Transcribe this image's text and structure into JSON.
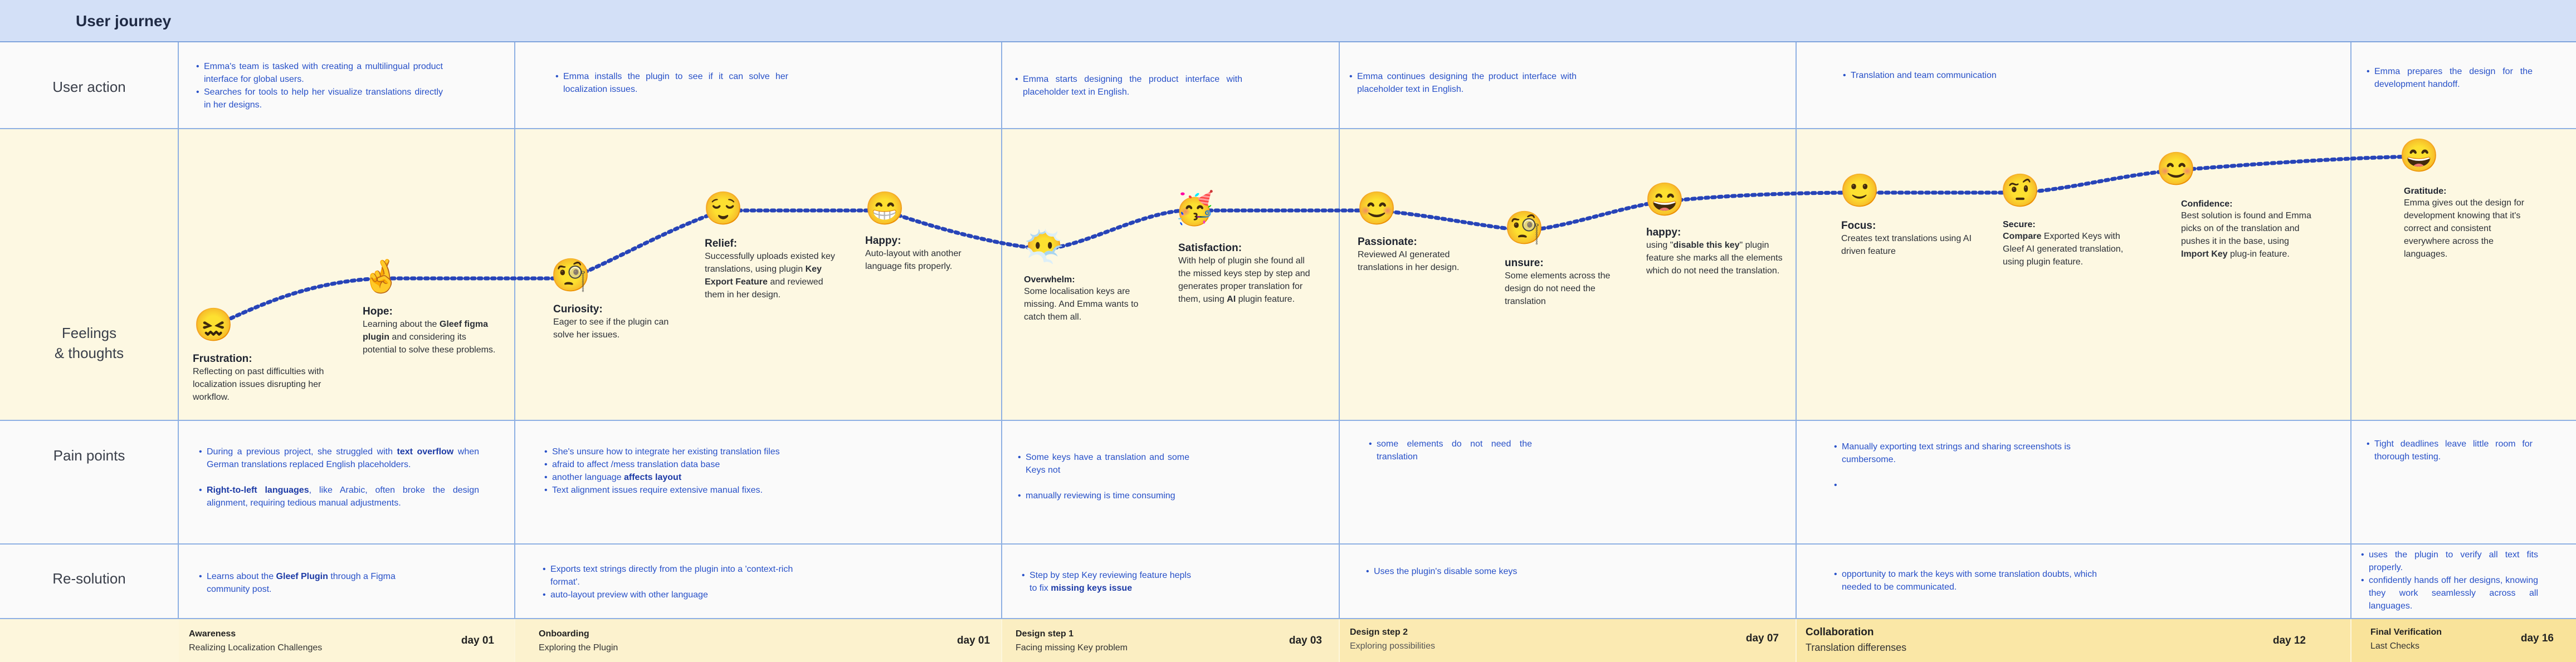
{
  "title": "User journey",
  "rows": {
    "user_action": "User action",
    "feelings_line1": "Feelings",
    "feelings_line2": "& thoughts",
    "pain_points": "Pain points",
    "resolution": "Re-solution"
  },
  "user_actions": [
    [
      "Emma's team is tasked with creating a multilingual product interface for global users.",
      "Searches for tools to help her visualize translations directly in her designs."
    ],
    [
      "Emma installs the plugin to see if it can solve her localization issues."
    ],
    [
      "Emma starts designing the product interface with placeholder text in English."
    ],
    [
      "Emma continues designing the product interface with placeholder text in English."
    ],
    [
      "Translation and team communication"
    ],
    [
      "Emma prepares the design for the development handoff."
    ]
  ],
  "emotions": [
    {
      "icon": "confounded-face-icon",
      "glyph": "😖",
      "title": "Frustration:",
      "text": "Reflecting on past difficulties with localization issues disrupting her workflow."
    },
    {
      "icon": "crossed-fingers-icon",
      "glyph": "🤞",
      "title": "Hope:",
      "pre": "Learning about the ",
      "bold": "Gleef figma plugin",
      "post": " and considering its potential to solve these problems."
    },
    {
      "icon": "face-with-monocle-icon",
      "glyph": "🧐",
      "title": "Curiosity:",
      "text": "Eager to see if the plugin can solve her issues."
    },
    {
      "icon": "relieved-face-icon",
      "glyph": "😌",
      "title": "Relief:",
      "pre": "Successfully uploads existed key translations, using plugin ",
      "bold": "Key Export Feature",
      "post": " and reviewed them in her design."
    },
    {
      "icon": "grinning-face-icon",
      "glyph": "😁",
      "title": "Happy:",
      "text": "Auto-layout with another language fits properly."
    },
    {
      "icon": "face-in-clouds-icon",
      "glyph": "😶‍🌫️",
      "title": "Overwhelm:",
      "text": "Some localisation keys are missing. And Emma wants to catch them all."
    },
    {
      "icon": "partying-face-icon",
      "glyph": "🥳",
      "title": "Satisfaction:",
      "pre": "With help of plugin she found all the missed keys step by step and generates proper translation for them, using ",
      "bold": "AI",
      "post": " plugin feature."
    },
    {
      "icon": "smiling-face-icon",
      "glyph": "😊",
      "title": "Passionate:",
      "text": "Reviewed AI generated translations in her design."
    },
    {
      "icon": "monocle-face-icon",
      "glyph": "🧐",
      "title": "unsure:",
      "text": "Some elements across the design do not need the translation"
    },
    {
      "icon": "smiling-eyes-icon",
      "glyph": "😄",
      "title": "happy:",
      "pre": "using \"",
      "bold": "disable this key",
      "post": "\" plugin feature she marks all the elements which do not need the translation."
    },
    {
      "icon": "slightly-smiling-face-icon",
      "glyph": "🙂",
      "title": "Focus:",
      "text": "Creates text translations using AI driven feature"
    },
    {
      "icon": "raised-eyebrow-icon",
      "glyph": "🤨",
      "title": "Secure:",
      "pre": "",
      "bold": "Compare",
      "post": " Exported Keys with Gleef AI generated translation, using plugin feature."
    },
    {
      "icon": "confident-face-icon",
      "glyph": "😊",
      "title": "Confidence:",
      "pre": "Best solution is found and Emma picks on of the translation and pushes it in the base, using ",
      "bold": "Import Key",
      "post": " plug-in feature."
    },
    {
      "icon": "grateful-face-icon",
      "glyph": "😄",
      "title": "Gratitude:",
      "text": "Emma gives out the design for development knowing that it's correct and consistent everywhere across the languages."
    }
  ],
  "pain_points": [
    {
      "items": [
        {
          "pre": "During a previous project, she struggled with ",
          "bold": "text overflow",
          "post": " when German translations replaced English placeholders."
        },
        {
          "pre": "",
          "bold": "Right-to-left languages",
          "post": ", like Arabic, often broke the design alignment, requiring tedious manual adjustments."
        }
      ]
    },
    {
      "items": [
        {
          "pre": "She's unsure how to integrate her existing translation files",
          "bold": "",
          "post": ""
        },
        {
          "pre": "afraid to affect /mess translation data base",
          "bold": "",
          "post": ""
        },
        {
          "pre": "another language ",
          "bold": "affects layout",
          "post": ""
        },
        {
          "pre": " Text alignment issues require extensive manual fixes.",
          "bold": "",
          "post": ""
        }
      ]
    },
    {
      "items": [
        {
          "pre": "Some keys have a translation and some Keys not",
          "bold": "",
          "post": ""
        },
        {
          "pre": "manually reviewing is time consuming",
          "bold": "",
          "post": ""
        }
      ]
    },
    {
      "items": [
        {
          "pre": "some elements do not need the translation",
          "bold": "",
          "post": ""
        }
      ]
    },
    {
      "items": [
        {
          "pre": "Manually exporting text strings and sharing screenshots is cumbersome.",
          "bold": "",
          "post": ""
        },
        {
          "pre": "",
          "bold": "",
          "post": ""
        }
      ]
    },
    {
      "items": [
        {
          "pre": "Tight deadlines leave little room for thorough testing.",
          "bold": "",
          "post": ""
        }
      ]
    }
  ],
  "resolutions": [
    {
      "items": [
        {
          "pre": "Learns about the ",
          "bold": "Gleef Plugin",
          "post": " through a Figma community post."
        }
      ]
    },
    {
      "items": [
        {
          "pre": "Exports text strings directly from the plugin into a 'context-rich format'.",
          "bold": "",
          "post": ""
        },
        {
          "pre": "auto-layout preview with other language",
          "bold": "",
          "post": ""
        }
      ]
    },
    {
      "items": [
        {
          "pre": "Step by step Key reviewing feature hepls to fix ",
          "bold": "missing keys issue",
          "post": ""
        }
      ]
    },
    {
      "items": [
        {
          "pre": "Uses the plugin's disable some keys",
          "bold": "",
          "post": ""
        }
      ]
    },
    {
      "items": [
        {
          "pre": "opportunity to mark the keys with some translation doubts, which needed to be communicated.",
          "bold": "",
          "post": ""
        }
      ]
    },
    {
      "items": [
        {
          "pre": "uses the plugin to verify all text fits properly.",
          "bold": "",
          "post": ""
        },
        {
          "pre": "confidently hands off her designs, knowing they work seamlessly across all languages.",
          "bold": "",
          "post": ""
        }
      ]
    }
  ],
  "stages": [
    {
      "name": "Awareness",
      "sub": "Realizing Localization Challenges",
      "day": "day 01",
      "color": "#fdf5d7"
    },
    {
      "name": "Onboarding",
      "sub": "Exploring the Plugin",
      "day": "day 01",
      "color": "#fcf2ce"
    },
    {
      "name": "Design step 1",
      "sub": "Facing missing Key problem",
      "day": "day 03",
      "color": "#fbeec2"
    },
    {
      "name": "Design step 2",
      "sub": "Exploring possibilities",
      "day": "day 07",
      "color": "#fbeab2"
    },
    {
      "name": "Collaboration",
      "sub": "Translation differenses",
      "day": "day 12",
      "color": "#fae7a6"
    },
    {
      "name": "Final Verification",
      "sub": "Last Checks",
      "day": "day 16",
      "color": "#f9e39a"
    }
  ],
  "colors": {
    "header": "#d3e0f7",
    "grid": "#8eb0e3",
    "feelings_band": "#fdf8e2",
    "curve": "#2744b8",
    "bullet_text": "#2750c8"
  }
}
